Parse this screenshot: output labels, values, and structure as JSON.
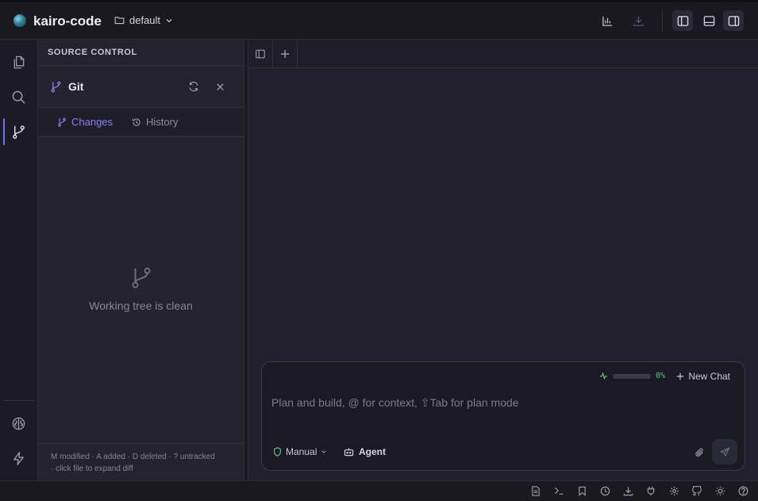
{
  "app": {
    "name": "kairo-code",
    "workspace": "default"
  },
  "topbar": {
    "icons": [
      "chart-icon",
      "download-icon",
      "toggle-left-panel-icon",
      "toggle-bottom-panel-icon",
      "toggle-right-panel-icon"
    ]
  },
  "activity_bar": {
    "items": [
      "files-icon",
      "search-icon",
      "git-branch-icon"
    ],
    "bottom_items": [
      "brain-icon",
      "lightning-icon"
    ],
    "active": "git-branch-icon"
  },
  "source_control": {
    "header": "SOURCE CONTROL",
    "title": "Git",
    "tabs": [
      {
        "label": "Changes",
        "icon": "git-branch-icon",
        "active": true
      },
      {
        "label": "History",
        "icon": "history-icon",
        "active": false
      }
    ],
    "empty_message": "Working tree is clean",
    "legend_line1": "M modified · A added · D deleted · ? untracked",
    "legend_line2": "· click file to expand diff"
  },
  "chat": {
    "context_percent_text": "0%",
    "context_fraction": 0,
    "new_chat_label": "New Chat",
    "input_value": "",
    "placeholder": "Plan and build, @ for context, ⇧Tab for plan mode",
    "mode_label": "Manual",
    "agent_label": "Agent"
  },
  "statusbar": {
    "icons": [
      "document-icon",
      "terminal-icon",
      "bookmark-icon",
      "clock-icon",
      "download-icon",
      "plug-icon",
      "settings-icon",
      "github-icon",
      "sun-icon",
      "help-icon"
    ]
  },
  "colors": {
    "accent": "#7c6ff2",
    "success": "#5fbf86",
    "background": "#1b1a24"
  }
}
